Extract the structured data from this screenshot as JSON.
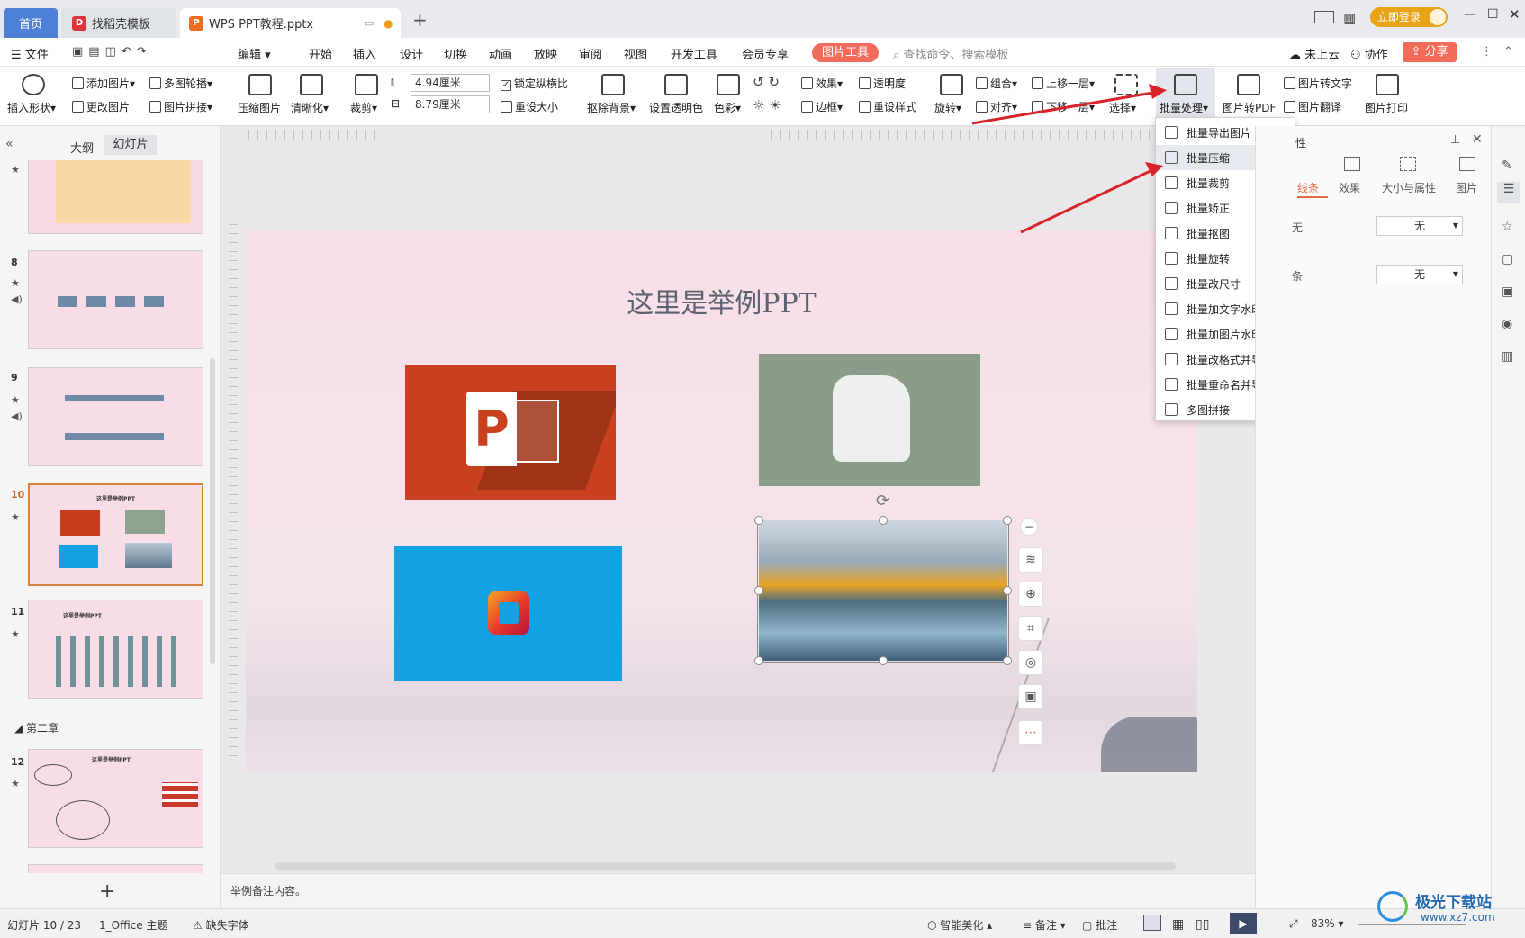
{
  "tabs": {
    "home": "首页",
    "template": "找稻壳模板",
    "document": "WPS PPT教程.pptx",
    "login": "立即登录"
  },
  "menu": {
    "file": "文件",
    "edit": "编辑",
    "items": [
      "开始",
      "插入",
      "设计",
      "切换",
      "动画",
      "放映",
      "审阅",
      "视图",
      "开发工具",
      "会员专享"
    ],
    "picture_tool": "图片工具",
    "search_placeholder": "查找命令、搜索模板",
    "cloud": "未上云",
    "collab": "协作",
    "share": "分享"
  },
  "ribbon": {
    "insert_shape": "插入形状",
    "add_image": "添加图片",
    "multi_carousel": "多图轮播",
    "change_image": "更改图片",
    "image_collage": "图片拼接",
    "compress": "压缩图片",
    "sharpen": "清晰化",
    "crop": "裁剪",
    "width": "4.94厘米",
    "height": "8.79厘米",
    "lock_ratio": "锁定纵横比",
    "reset_size": "重设大小",
    "remove_bg": "抠除背景",
    "set_transparent": "设置透明色",
    "color": "色彩",
    "effects": "效果",
    "transparency": "透明度",
    "border": "边框",
    "reset_style": "重设样式",
    "rotate": "旋转",
    "group": "组合",
    "align": "对齐",
    "bring_forward": "上移一层",
    "send_backward": "下移一层",
    "select": "选择",
    "batch": "批量处理",
    "to_pdf": "图片转PDF",
    "to_text": "图片转文字",
    "translate": "图片翻译",
    "print": "图片打印"
  },
  "dropdown_items": [
    "批量导出图片",
    "批量压缩",
    "批量裁剪",
    "批量矫正",
    "批量抠图",
    "批量旋转",
    "批量改尺寸",
    "批量加文字水印",
    "批量加图片水印",
    "批量改格式并导出",
    "批量重命名并导出",
    "多图拼接"
  ],
  "left_panel": {
    "outline_tab": "大纲",
    "slides_tab": "幻灯片",
    "slide_numbers": [
      "8",
      "9",
      "10",
      "11",
      "12"
    ],
    "section": "第二章",
    "thumb10_title": "这里是举例PPT",
    "thumb11_title": "这里是举例PPT",
    "thumb12_title": "这里是举例PPT"
  },
  "slide": {
    "title": "这里是举例PPT"
  },
  "right_panel": {
    "header": "性",
    "tabs": [
      "线条",
      "效果",
      "大小与属性",
      "图片"
    ],
    "value1": "无",
    "value2": "无",
    "label1": "无",
    "label2": "条"
  },
  "notes": "举例备注内容。",
  "status": {
    "slide_info": "幻灯片 10 / 23",
    "theme": "1_Office 主题",
    "missing_font": "缺失字体",
    "smart_beautify": "智能美化",
    "notes": "备注",
    "comments": "批注",
    "zoom": "83%"
  },
  "watermark": {
    "name": "极光下载站",
    "url": "www.xz7.com"
  },
  "colors": {
    "accent": "#f36b5b",
    "home_tab": "#4e80d8",
    "login": "#e8a317",
    "arrow": "#d9232a"
  }
}
